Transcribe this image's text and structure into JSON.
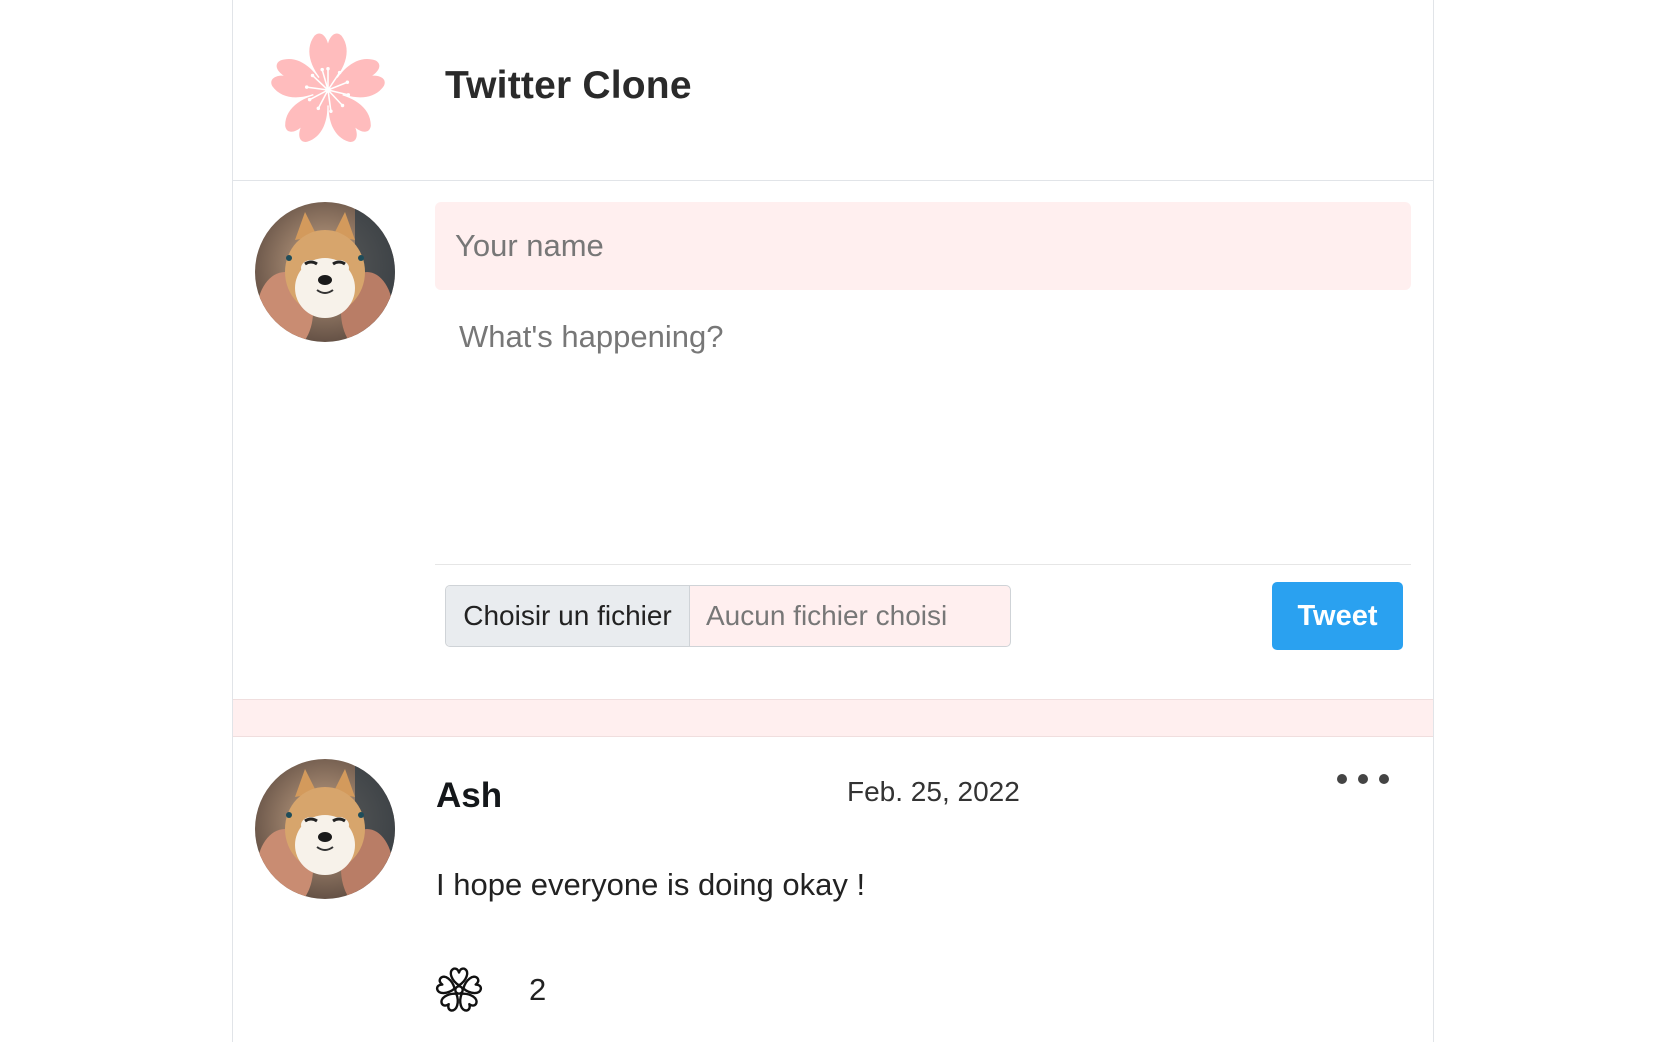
{
  "header": {
    "title": "Twitter Clone",
    "logo_icon": "cherry-blossom-icon"
  },
  "composer": {
    "name_placeholder": "Your name",
    "message_placeholder": "What's happening?",
    "file_button_label": "Choisir un fichier",
    "file_status": "Aucun fichier choisi",
    "tweet_button_label": "Tweet"
  },
  "tweets": [
    {
      "author": "Ash",
      "date": "Feb. 25, 2022",
      "text": "I hope everyone is doing okay !",
      "likes": "2",
      "like_icon": "flower-outline-icon",
      "menu_icon": "more-dots-icon"
    }
  ],
  "colors": {
    "accent": "#2aa1f0",
    "logo_pink": "#ffbcbd",
    "input_background": "#ffefef"
  }
}
